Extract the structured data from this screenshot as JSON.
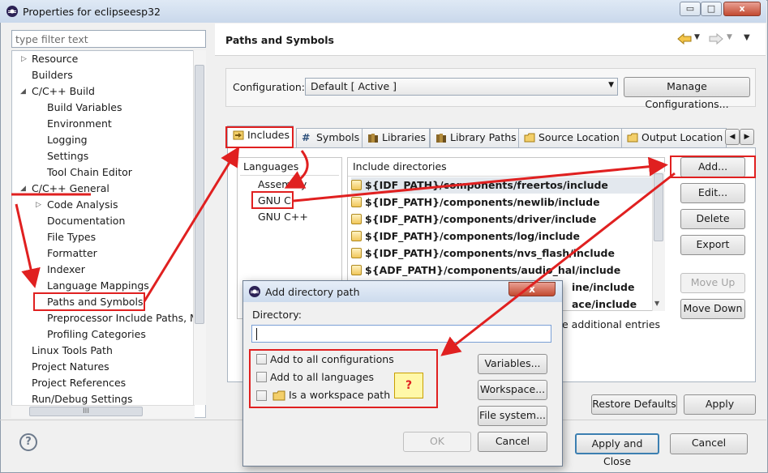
{
  "window": {
    "title": "Properties for eclipseesp32",
    "minimize_glyph": "▭",
    "maximize_glyph": "□",
    "close_glyph": "x"
  },
  "filter": {
    "placeholder": "type filter text"
  },
  "tree": {
    "items": [
      "Resource",
      "Builders",
      "C/C++ Build",
      "Build Variables",
      "Environment",
      "Logging",
      "Settings",
      "Tool Chain Editor",
      "C/C++ General",
      "Code Analysis",
      "Documentation",
      "File Types",
      "Formatter",
      "Indexer",
      "Language Mappings",
      "Paths and Symbols",
      "Preprocessor Include Paths, M",
      "Profiling Categories",
      "Linux Tools Path",
      "Project Natures",
      "Project References",
      "Run/Debug Settings"
    ],
    "hscroll_grip": "III"
  },
  "panel": {
    "title": "Paths and Symbols",
    "nav_back_icon": "arrow-left-icon",
    "nav_forward_icon": "arrow-right-icon"
  },
  "configuration": {
    "label": "Configuration:",
    "value": "Default  [ Active ]",
    "manage_label": "Manage Configurations..."
  },
  "tabs": [
    {
      "label": "Includes",
      "icon": "includes-icon"
    },
    {
      "label": "Symbols",
      "icon": "hash-icon"
    },
    {
      "label": "Libraries",
      "icon": "library-icon"
    },
    {
      "label": "Library Paths",
      "icon": "library-path-icon"
    },
    {
      "label": "Source Location",
      "icon": "folder-icon"
    },
    {
      "label": "Output Location",
      "icon": "folder-icon"
    }
  ],
  "languages": {
    "header": "Languages",
    "items": [
      "Assembly",
      "GNU C",
      "GNU C++"
    ]
  },
  "includes": {
    "header": "Include directories",
    "rows": [
      "${IDF_PATH}/components/freertos/include",
      "${IDF_PATH}/components/newlib/include",
      "${IDF_PATH}/components/driver/include",
      "${IDF_PATH}/components/log/include",
      "${IDF_PATH}/components/nvs_flash/include",
      "${ADF_PATH}/components/audio_hal/include"
    ],
    "partial_rows": [
      "ine/include",
      "ace/include"
    ],
    "additional_text": "e additional entries"
  },
  "side_buttons": {
    "add": "Add...",
    "edit": "Edit...",
    "delete": "Delete",
    "export": "Export",
    "move_up": "Move Up",
    "move_down": "Move Down"
  },
  "footer": {
    "restore_defaults": "Restore Defaults",
    "apply": "Apply",
    "apply_and_close": "Apply and Close",
    "cancel": "Cancel",
    "help_glyph": "?"
  },
  "dialog": {
    "title": "Add directory path",
    "close_glyph": "x",
    "directory_label": "Directory:",
    "directory_value": "",
    "add_all_configurations": "Add to all configurations",
    "add_all_languages": "Add to all languages",
    "workspace_path": "Is a workspace path",
    "variables": "Variables...",
    "workspace": "Workspace...",
    "file_system": "File system...",
    "ok": "OK",
    "cancel": "Cancel",
    "question_mark": "?"
  },
  "colors": {
    "annotation": "#e02020",
    "active_tab": "#ffffff",
    "apply_close_border": "#3c7fb1"
  }
}
